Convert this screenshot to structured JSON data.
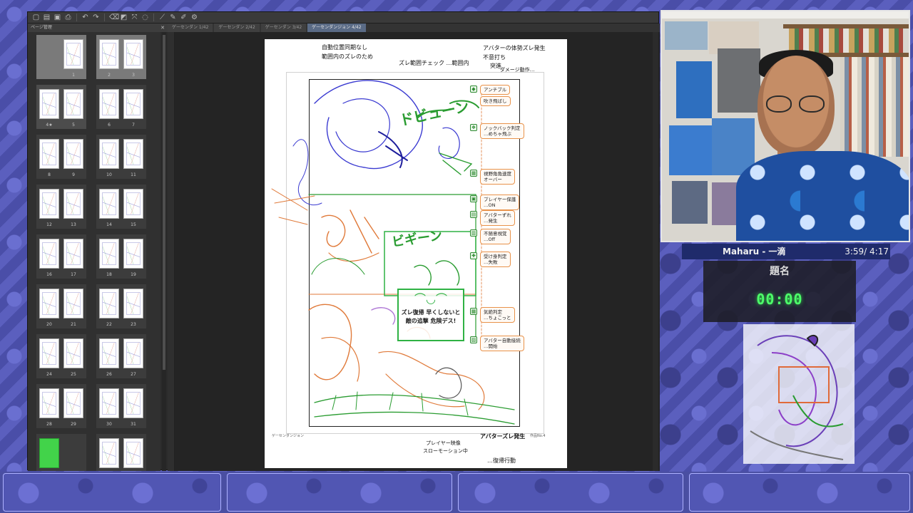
{
  "app": {
    "panel_tab": "ページ管理",
    "doc_tabs": [
      {
        "label": "ゲーセンダン 1/42",
        "active": false
      },
      {
        "label": "ゲーセンダン 2/42",
        "active": false
      },
      {
        "label": "ゲーセンダン 3/42",
        "active": false
      },
      {
        "label": "ゲーセンダンジョン 4/42",
        "active": true
      }
    ],
    "page_labels": [
      "1",
      "2",
      "3",
      "4★",
      "5",
      "6",
      "7",
      "8",
      "9",
      "10",
      "11",
      "12",
      "13",
      "14",
      "15",
      "16",
      "17",
      "18",
      "19",
      "20",
      "21",
      "22",
      "23",
      "24",
      "25",
      "26",
      "27",
      "28",
      "29",
      "30",
      "31"
    ]
  },
  "manuscript": {
    "top_notes": {
      "left1": "自動位置同期なし",
      "left2": "範囲内のズレのため",
      "center": "ズレ範囲チェック …範囲内",
      "right1": "アバターの体勢ズレ発生",
      "right2": "不意打ち",
      "right3": "突進",
      "right4": "ダメージ動作…"
    },
    "annotations": [
      "アンチブル",
      "吹き飛ばし",
      "ノックバック判定\n…めちゃ飛ぶ",
      "視野角角速度\nオーバー",
      "プレイヤー保護\n…ON",
      "アバターずれ\n…発生",
      "不随意視覚\n…Off",
      "受け身判定\n…失敗",
      "気絶判定\n…ちょこっと",
      "アバター自動接続\n…開始"
    ],
    "sfx1": "ドビューン",
    "sfx2": "ビギーン",
    "warning": "ズレ復帰 早くしないと\n敵の追撃 危険デス!",
    "bottom_notes": {
      "left_small": "ゲーセンダンジョン",
      "right_small": "作品No.4",
      "right": "アバターズレ発生",
      "center1": "プレイヤー映像",
      "center2": "スローモーション中",
      "center3": "…復帰行動"
    }
  },
  "music": {
    "track": "Maharu - 一滴",
    "time": "3:59/ 4:17"
  },
  "timer": {
    "title": "題名",
    "value": "00:00"
  }
}
